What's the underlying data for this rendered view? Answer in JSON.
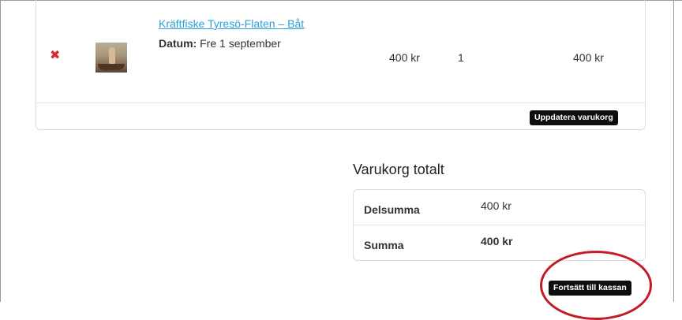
{
  "cart": {
    "item": {
      "remove_icon": "close-icon",
      "product_name": "Kräftfiske Tyresö-Flaten – Båt",
      "date_label": "Datum:",
      "date_value": "Fre 1 september",
      "price": "400 kr",
      "quantity": "1",
      "subtotal": "400 kr"
    },
    "update_button_label": "Uppdatera varukorg"
  },
  "totals": {
    "title": "Varukorg totalt",
    "rows": [
      {
        "label": "Delsumma",
        "value": "400 kr"
      },
      {
        "label": "Summa",
        "value": "400 kr"
      }
    ],
    "checkout_button_label": "Fortsätt till kassan"
  },
  "colors": {
    "link": "#2aa1d8",
    "remove": "#d9262f",
    "button_bg": "#0e0e0e",
    "highlight": "#c41c24"
  }
}
